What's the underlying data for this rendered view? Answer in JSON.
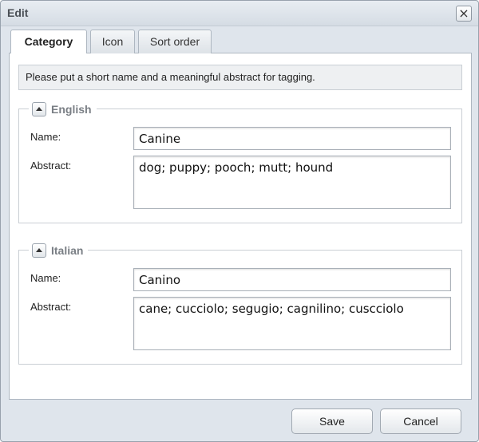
{
  "window": {
    "title": "Edit"
  },
  "tabs": [
    {
      "label": "Category",
      "active": true
    },
    {
      "label": "Icon",
      "active": false
    },
    {
      "label": "Sort order",
      "active": false
    }
  ],
  "info": "Please put a short name and a meaningful abstract for tagging.",
  "groups": {
    "english": {
      "legend": "English",
      "name_label": "Name:",
      "name_value": "Canine",
      "abstract_label": "Abstract:",
      "abstract_value": "dog; puppy; pooch; mutt; hound"
    },
    "italian": {
      "legend": "Italian",
      "name_label": "Name:",
      "name_value": "Canino",
      "abstract_label": "Abstract:",
      "abstract_value": "cane; cucciolo; segugio; cagnilino; cuscciolo"
    }
  },
  "buttons": {
    "save": "Save",
    "cancel": "Cancel"
  },
  "icons": {
    "close": "close-icon",
    "collapse": "chevron-up-icon"
  }
}
